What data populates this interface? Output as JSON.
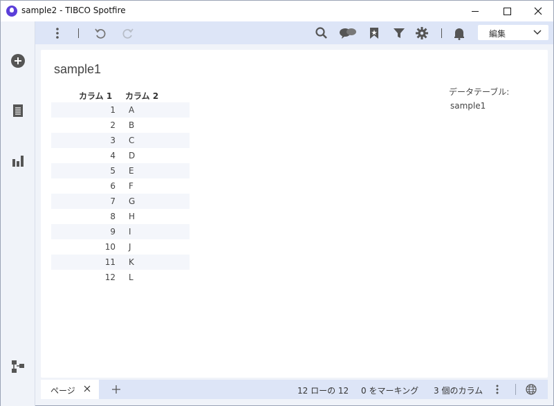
{
  "window": {
    "title": "sample2 - TIBCO Spotfire"
  },
  "toolbar": {
    "mode_label": "編集"
  },
  "visualization": {
    "title": "sample1",
    "columns": [
      "カラム 1",
      "カラム 2"
    ],
    "rows": [
      [
        "1",
        "A"
      ],
      [
        "2",
        "B"
      ],
      [
        "3",
        "C"
      ],
      [
        "4",
        "D"
      ],
      [
        "5",
        "E"
      ],
      [
        "6",
        "F"
      ],
      [
        "7",
        "G"
      ],
      [
        "8",
        "H"
      ],
      [
        "9",
        "I"
      ],
      [
        "10",
        "J"
      ],
      [
        "11",
        "K"
      ],
      [
        "12",
        "L"
      ]
    ]
  },
  "details": {
    "data_table_label": "データテーブル:",
    "data_table_value": "sample1"
  },
  "statusbar": {
    "page_tab": "ページ",
    "rows_text": "12 ローの 12",
    "marking_text": "0 をマーキング",
    "columns_text": "3 個のカラム"
  },
  "colors": {
    "accent": "#5b3fd9",
    "toolbar_bg": "#dde5f7",
    "rail_bg": "#f0f3f9"
  }
}
